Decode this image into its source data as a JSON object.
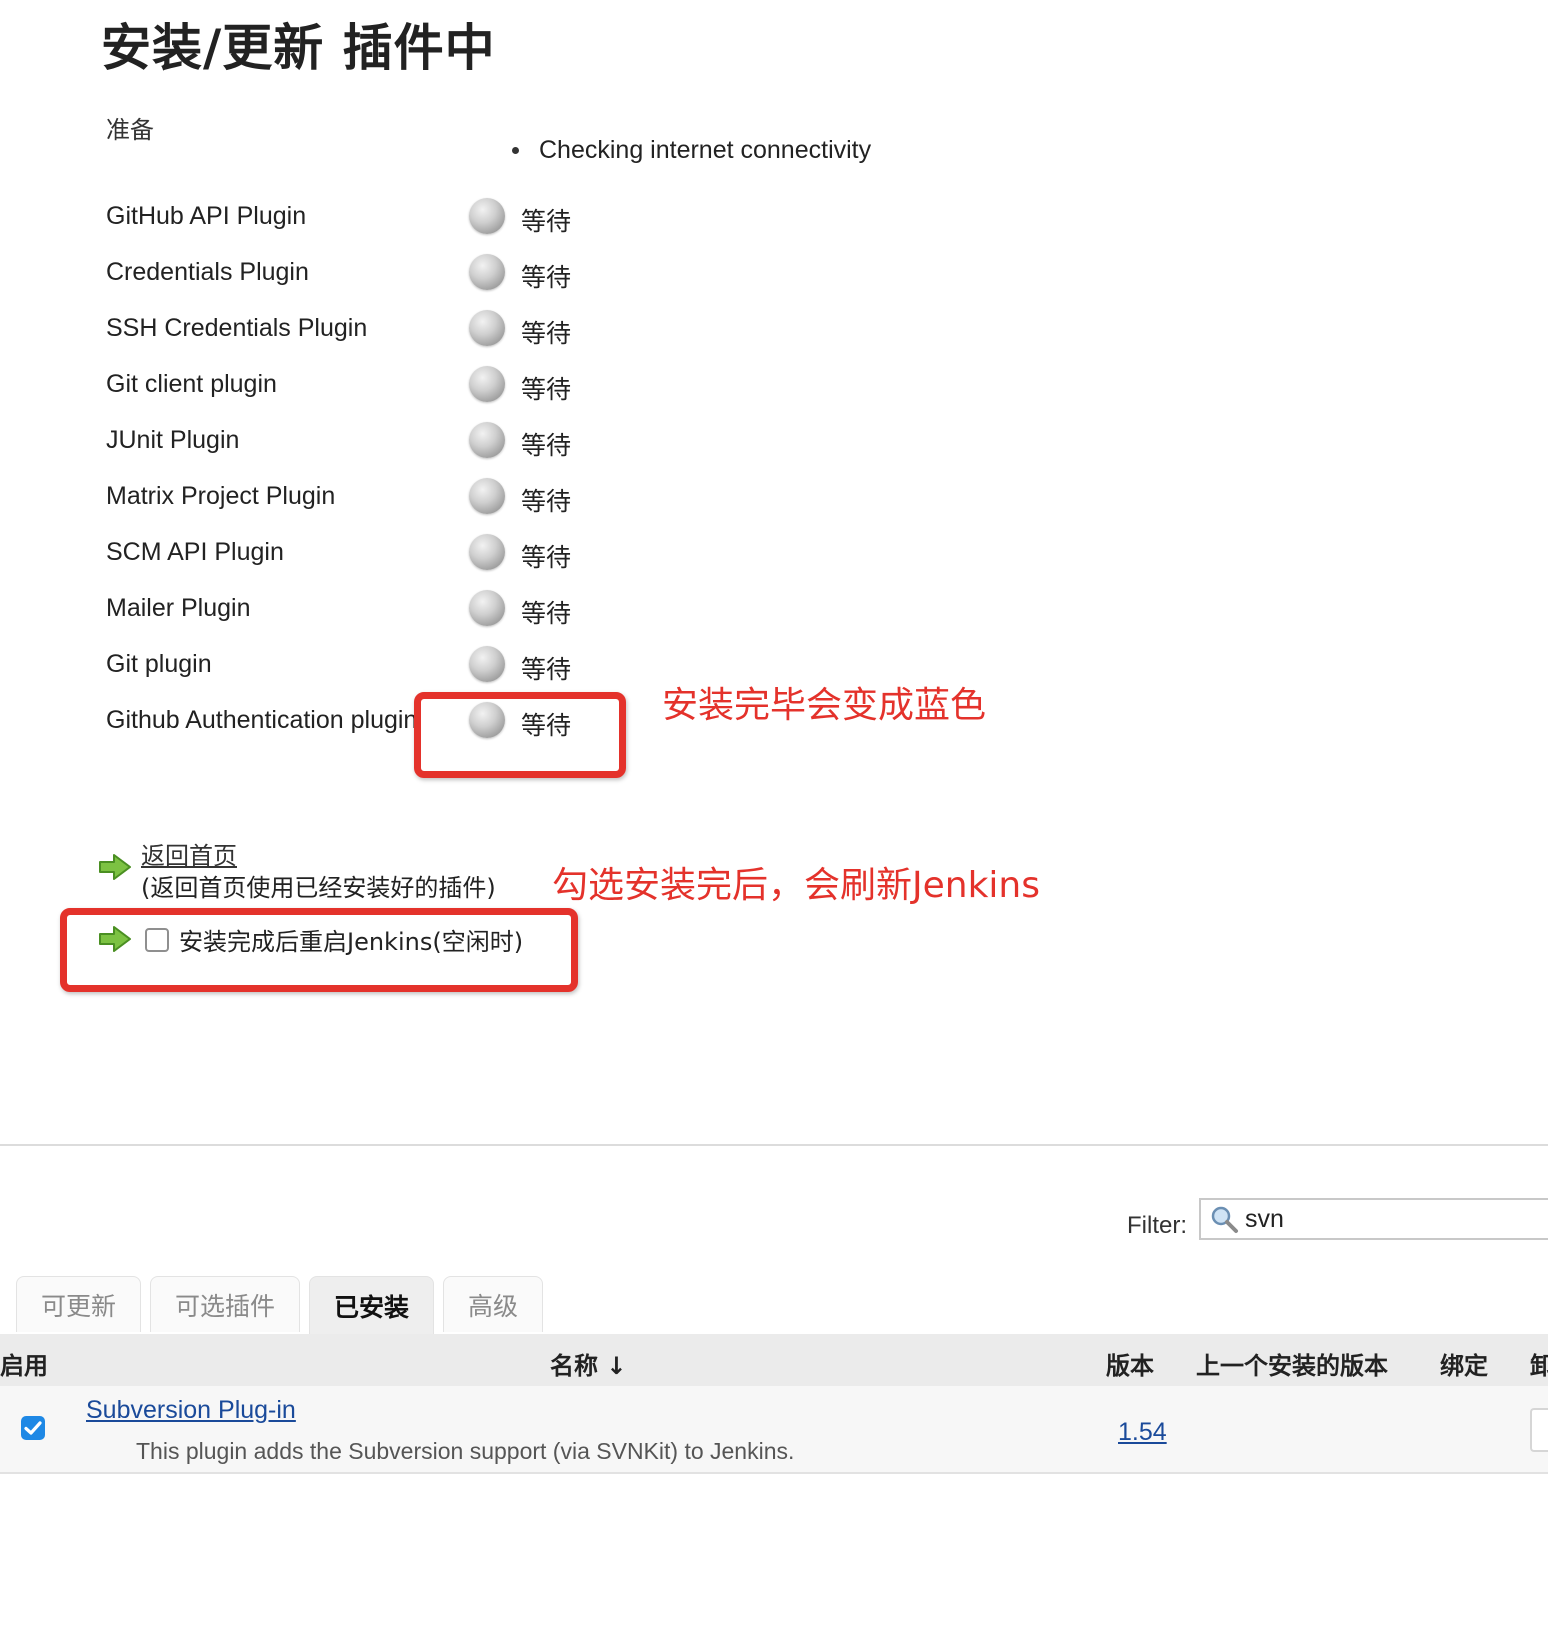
{
  "page": {
    "title": "安装/更新 插件中",
    "section_label": "准备",
    "connectivity": "Checking internet connectivity"
  },
  "plugins": [
    {
      "name": "GitHub API Plugin",
      "status": "等待"
    },
    {
      "name": "Credentials Plugin",
      "status": "等待"
    },
    {
      "name": "SSH Credentials Plugin",
      "status": "等待"
    },
    {
      "name": "Git client plugin",
      "status": "等待"
    },
    {
      "name": "JUnit Plugin",
      "status": "等待"
    },
    {
      "name": "Matrix Project Plugin",
      "status": "等待"
    },
    {
      "name": "SCM API Plugin",
      "status": "等待"
    },
    {
      "name": "Mailer Plugin",
      "status": "等待"
    },
    {
      "name": "Git plugin",
      "status": "等待"
    },
    {
      "name": "Github Authentication plugin",
      "status": "等待"
    }
  ],
  "annotations": {
    "blue_note": "安装完毕会变成蓝色",
    "refresh_note": "勾选安装完后，会刷新Jenkins",
    "color": "#e4322b"
  },
  "actions": {
    "home_link": "返回首页",
    "home_note": "(返回首页使用已经安装好的插件)",
    "restart_label": "安装完成后重启Jenkins(空闲时)",
    "restart_checked": false
  },
  "filter": {
    "label": "Filter:",
    "value": "svn"
  },
  "tabs": [
    {
      "label": "可更新",
      "active": false
    },
    {
      "label": "可选插件",
      "active": false
    },
    {
      "label": "已安装",
      "active": true
    },
    {
      "label": "高级",
      "active": false
    }
  ],
  "table": {
    "headers": {
      "enabled": "启用",
      "name": "名称 ↓",
      "version": "版本",
      "previous": "上一个安装的版本",
      "pinned": "绑定",
      "uninstall": "卸"
    },
    "rows": [
      {
        "enabled": true,
        "name": "Subversion Plug-in",
        "description": "This plugin adds the Subversion support (via SVNKit) to Jenkins.",
        "version": "1.54"
      }
    ]
  },
  "icons": {
    "status": "grey-ball-icon",
    "arrow": "green-arrow-icon",
    "search": "search-icon",
    "checkbox_color": "#1e88e5"
  }
}
